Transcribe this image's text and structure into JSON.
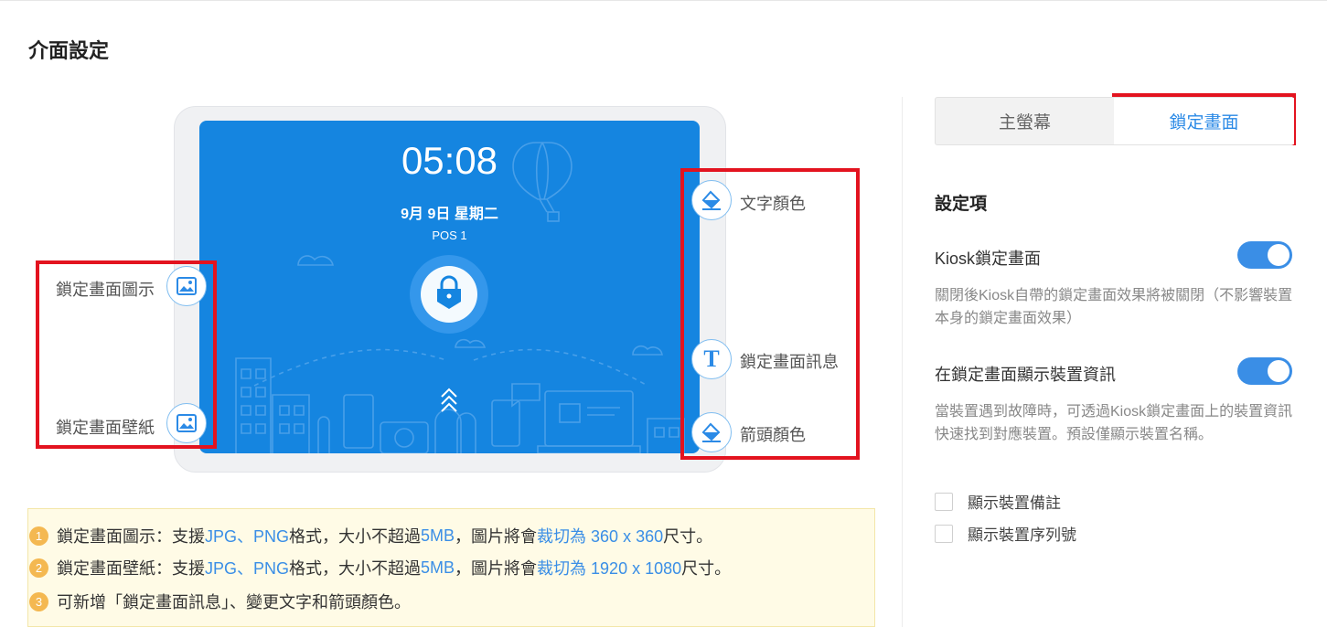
{
  "page": {
    "title": "介面設定"
  },
  "preview": {
    "time": "05:08",
    "date": "9月 9日 星期二",
    "device_name": "POS 1",
    "labels": {
      "lock_icon": "鎖定畫面圖示",
      "wallpaper": "鎖定畫面壁紙",
      "text_color": "文字顏色",
      "lock_message": "鎖定畫面訊息",
      "arrow_color": "箭頭顏色"
    },
    "icons": {
      "lock_icon": "image-icon",
      "wallpaper": "image-icon",
      "text_color": "paint-bucket-icon",
      "lock_message": "text-icon",
      "arrow_color": "paint-bucket-icon"
    }
  },
  "notes": [
    {
      "num": "1",
      "prefix": "鎖定畫面圖示：支援 ",
      "formats": "JPG、PNG",
      "mid": " 格式，大小不超過 ",
      "size": "5MB",
      "mid2": "，圖片將會",
      "crop": "裁切為 360 x 360",
      "suffix": " 尺寸。"
    },
    {
      "num": "2",
      "prefix": "鎖定畫面壁紙：支援 ",
      "formats": "JPG、PNG",
      "mid": " 格式，大小不超過 ",
      "size": "5MB",
      "mid2": "，圖片將會",
      "crop": "裁切為 1920 x 1080",
      "suffix": " 尺寸。"
    },
    {
      "num": "3",
      "text": "可新增「鎖定畫面訊息」、變更文字和箭頭顏色。"
    }
  ],
  "tabs": [
    {
      "label": "主螢幕",
      "active": false
    },
    {
      "label": "鎖定畫面",
      "active": true
    }
  ],
  "settings": {
    "title": "設定項",
    "kiosk_lock": {
      "label": "Kiosk鎖定畫面",
      "enabled": true,
      "description": "關閉後Kiosk自帶的鎖定畫面效果將被關閉（不影響裝置本身的鎖定畫面效果）"
    },
    "show_device_info": {
      "label": "在鎖定畫面顯示裝置資訊",
      "enabled": true,
      "description": "當裝置遇到故障時，可透過Kiosk鎖定畫面上的裝置資訊快速找到對應裝置。預設僅顯示裝置名稱。"
    },
    "checkboxes": [
      {
        "label": "顯示裝置備註",
        "checked": false
      },
      {
        "label": "顯示裝置序列號",
        "checked": false
      }
    ]
  },
  "colors": {
    "accent": "#3a8ee6",
    "screen": "#1585e0",
    "highlight": "#e3131f",
    "note_bg": "#fffbe6",
    "note_number": "#f4b851"
  }
}
